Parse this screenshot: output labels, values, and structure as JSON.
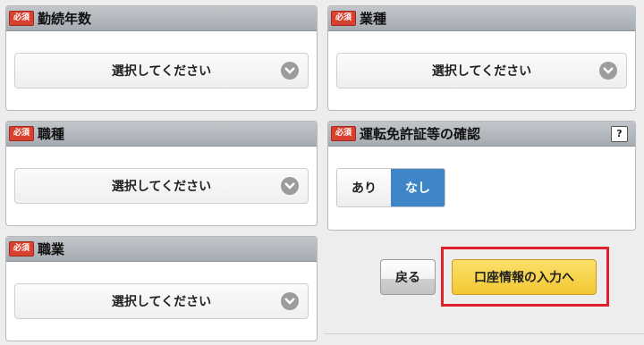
{
  "required_badge": "必須",
  "panels": {
    "years": {
      "title": "勤続年数",
      "select_value": "選択してください"
    },
    "industry": {
      "title": "業種",
      "select_value": "選択してください"
    },
    "job_type": {
      "title": "職種",
      "select_value": "選択してください"
    },
    "license": {
      "title": "運転免許証等の確認",
      "help_label": "?",
      "options": [
        "あり",
        "なし"
      ],
      "selected": "なし"
    },
    "occupation": {
      "title": "職業",
      "select_value": "選択してください"
    }
  },
  "buttons": {
    "back_label": "戻る",
    "next_label": "口座情報の入力へ"
  },
  "colors": {
    "required_badge": "#d8412f",
    "toggle_selected": "#3f86c8",
    "next_button": "#f5cf3f",
    "highlight_border": "#e0202a"
  }
}
